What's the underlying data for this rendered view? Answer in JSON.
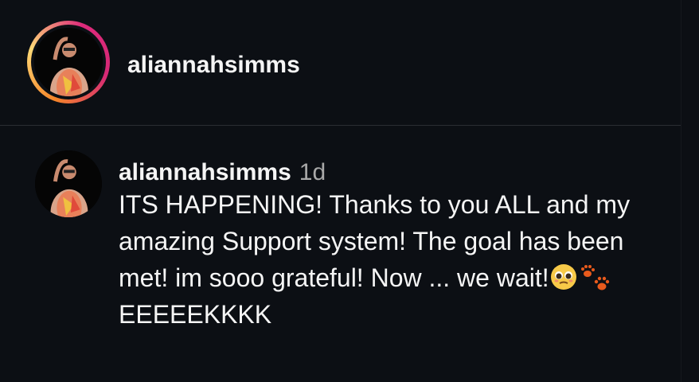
{
  "header": {
    "username": "aliannahsimms",
    "avatar_icon": "profile-photo"
  },
  "comment": {
    "username": "aliannahsimms",
    "time": "1d",
    "text_main": "ITS HAPPENING! Thanks to you ALL and my amazing Support system! The goal has been met! im sooo grateful! Now ... we wait!",
    "text_tail": "EEEEEKKKK",
    "emojis": [
      "pleading-face-emoji",
      "paw-prints-emoji"
    ]
  },
  "colors": {
    "background": "#0c0f14",
    "divider": "#2a2d33",
    "text": "#f5f5f5",
    "muted": "#a8a8a8",
    "story_ring": [
      "#f58529",
      "#feda77",
      "#dd2a7b"
    ]
  }
}
